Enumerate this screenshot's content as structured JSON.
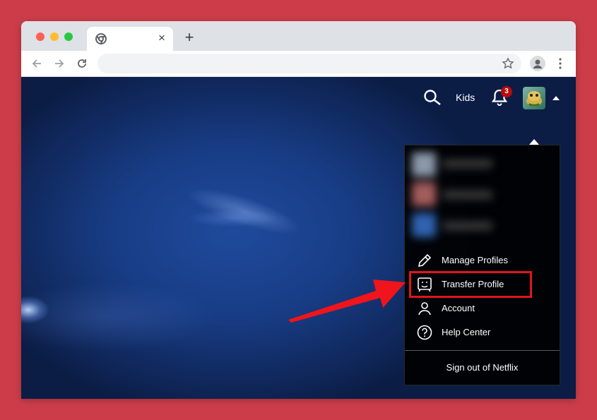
{
  "background_color": "#cc3d49",
  "browser": {
    "tab": {
      "title": "",
      "favicon": "chrome-icon",
      "close_label": "×"
    },
    "new_tab_label": "+",
    "address_bar": {
      "value": ""
    }
  },
  "netflix": {
    "nav": {
      "search_icon": "search-icon",
      "kids_label": "Kids",
      "notifications_icon": "bell-icon",
      "notifications_count": "3",
      "avatar_icon": "profile-avatar"
    },
    "menu": {
      "items": [
        {
          "label": "Manage Profiles",
          "icon": "pencil-icon"
        },
        {
          "label": "Transfer Profile",
          "icon": "transfer-profile-icon"
        },
        {
          "label": "Account",
          "icon": "person-icon"
        },
        {
          "label": "Help Center",
          "icon": "help-icon"
        }
      ],
      "sign_out_label": "Sign out of Netflix"
    },
    "accent_color": "#e0141f"
  }
}
